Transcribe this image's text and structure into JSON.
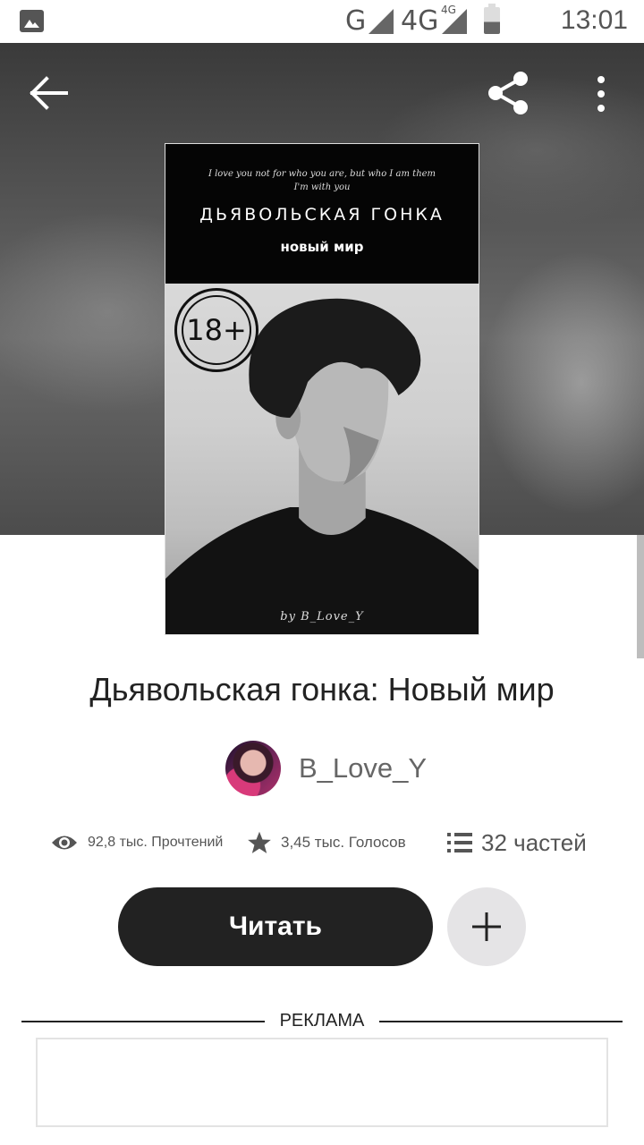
{
  "status_bar": {
    "network_g": "G",
    "network_4g": "4G",
    "network_4g_small": "4G",
    "time": "13:01"
  },
  "cover": {
    "quote": "I love you not for who you are, but who I am them I'm with you",
    "title": "ДЬЯВОЛЬСКАЯ ГОНКА",
    "subtitle": "новый мир",
    "age_badge": "18+",
    "author_line": "by B_Love_Y"
  },
  "book": {
    "title": "Дьявольская гонка: Новый мир",
    "author": "B_Love_Y"
  },
  "stats": {
    "reads": "92,8 тыс. Прочтений",
    "votes": "3,45 тыс. Голосов",
    "parts": "32 частей"
  },
  "actions": {
    "read_label": "Читать",
    "add_label": "+"
  },
  "ad": {
    "label": "РЕКЛАМА"
  },
  "icons": {
    "back": "arrow-left-icon",
    "share": "share-icon",
    "more": "more-vertical-icon",
    "eye": "eye-icon",
    "star": "star-icon",
    "list": "list-icon",
    "plus": "plus-icon"
  },
  "colors": {
    "primary_button": "#222222",
    "secondary_button": "#e5e4e6",
    "text_muted": "#666666"
  }
}
